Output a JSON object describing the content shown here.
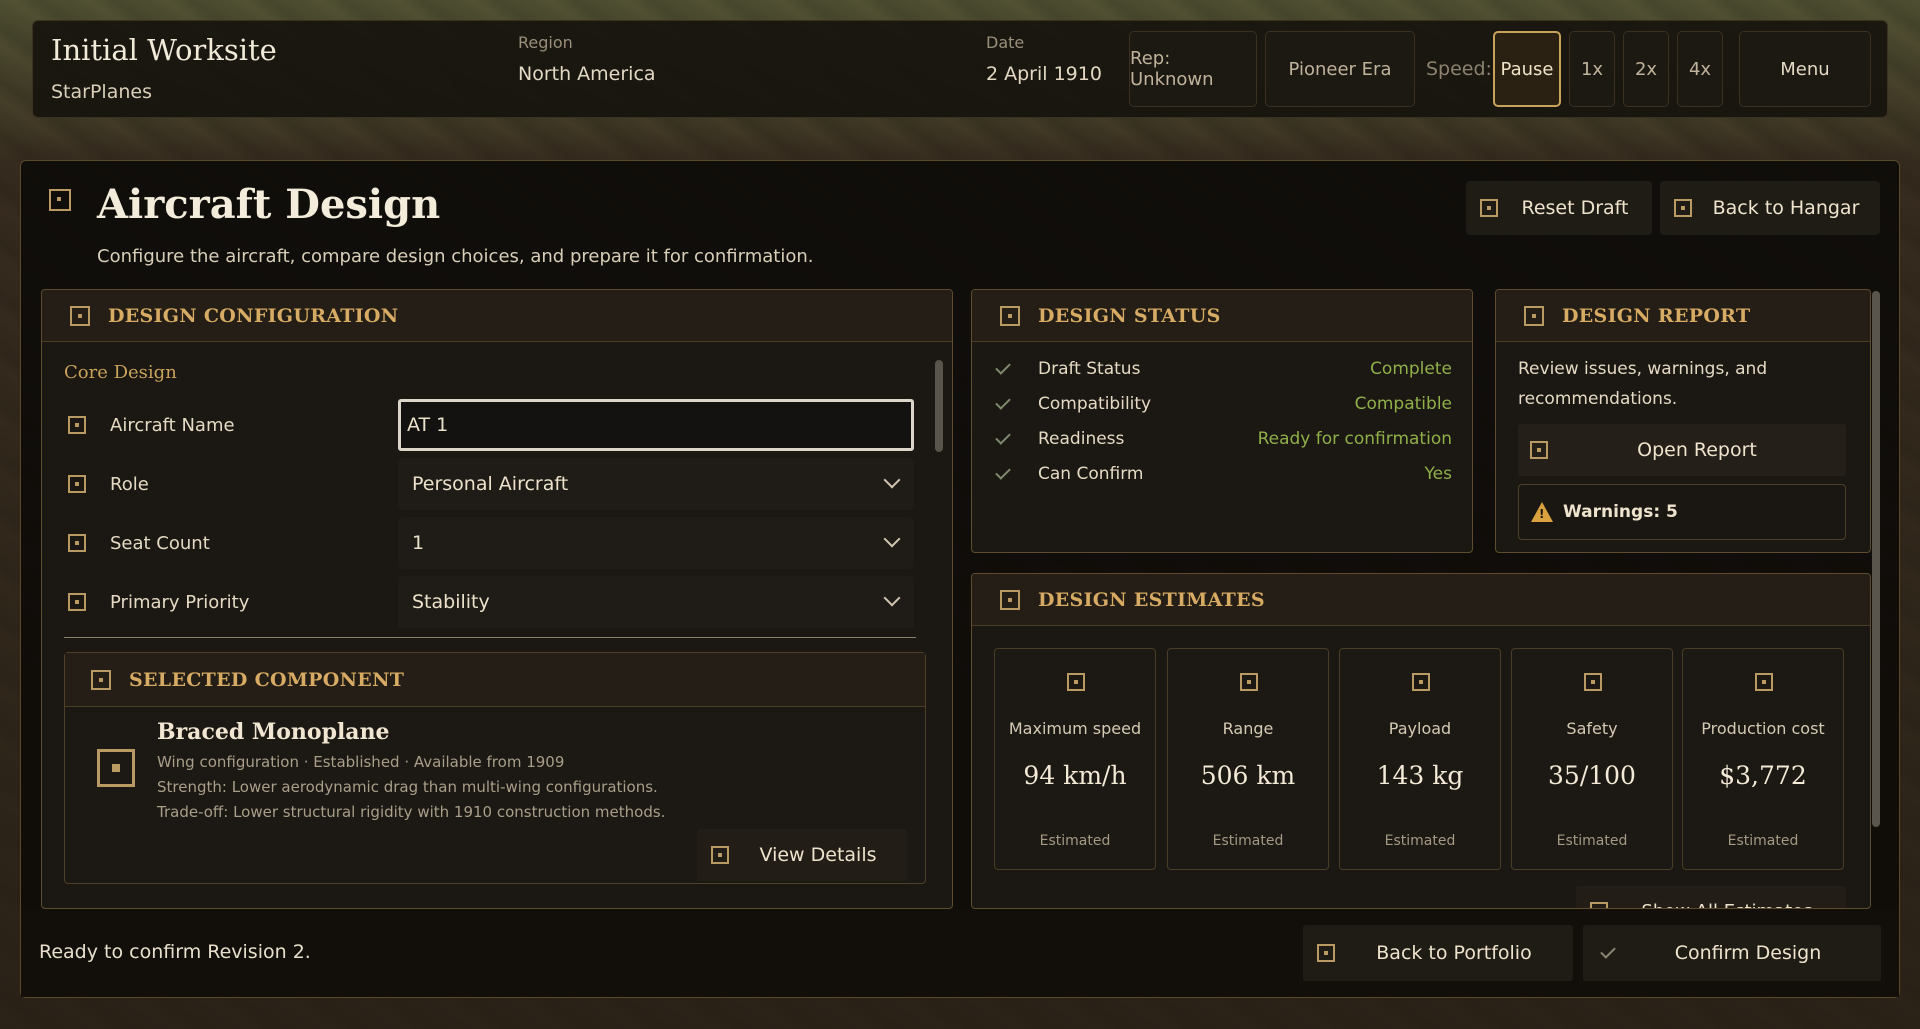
{
  "topbar": {
    "title": "Initial Worksite",
    "subtitle": "StarPlanes",
    "region_label": "Region",
    "region_value": "North America",
    "date_label": "Date",
    "date_value": "2 April 1910",
    "rep": "Rep: Unknown",
    "era": "Pioneer Era",
    "speed_label": "Speed:",
    "speed_options": [
      "Pause",
      "1x",
      "2x",
      "4x"
    ],
    "speed_selected": "Pause",
    "menu": "Menu"
  },
  "header": {
    "title": "Aircraft Design",
    "subtitle": "Configure the aircraft, compare design choices, and prepare it for confirmation.",
    "reset_label": "Reset Draft",
    "back_hangar_label": "Back to Hangar"
  },
  "config": {
    "title": "DESIGN CONFIGURATION",
    "section": "Core Design",
    "fields": [
      {
        "label": "Aircraft Name",
        "value": "AT 1"
      },
      {
        "label": "Role",
        "value": "Personal Aircraft"
      },
      {
        "label": "Seat Count",
        "value": "1"
      },
      {
        "label": "Primary Priority",
        "value": "Stability"
      }
    ],
    "component": {
      "title": "SELECTED COMPONENT",
      "name": "Braced Monoplane",
      "meta": "Wing configuration · Established · Available from 1909",
      "strength": "Strength: Lower aerodynamic drag than multi-wing configurations.",
      "tradeoff": "Trade-off: Lower structural rigidity with 1910 construction methods.",
      "view_label": "View Details"
    }
  },
  "status": {
    "title": "DESIGN STATUS",
    "rows": [
      {
        "label": "Draft Status",
        "value": "Complete"
      },
      {
        "label": "Compatibility",
        "value": "Compatible"
      },
      {
        "label": "Readiness",
        "value": "Ready for confirmation"
      },
      {
        "label": "Can Confirm",
        "value": "Yes"
      }
    ]
  },
  "report": {
    "title": "DESIGN REPORT",
    "text": "Review issues, warnings, and recommendations.",
    "open_label": "Open Report",
    "warnings": "Warnings: 5"
  },
  "estimates": {
    "title": "DESIGN ESTIMATES",
    "cards": [
      {
        "name": "Maximum speed",
        "value": "94 km/h",
        "note": "Estimated"
      },
      {
        "name": "Range",
        "value": "506 km",
        "note": "Estimated"
      },
      {
        "name": "Payload",
        "value": "143 kg",
        "note": "Estimated"
      },
      {
        "name": "Safety",
        "value": "35/100",
        "note": "Estimated"
      },
      {
        "name": "Production cost",
        "value": "$3,772",
        "note": "Estimated"
      }
    ],
    "show_all_label": "Show All Estimates"
  },
  "footer": {
    "status": "Ready to confirm Revision 2.",
    "back_portfolio_label": "Back to Portfolio",
    "confirm_label": "Confirm Design"
  },
  "colors": {
    "accent_gold": "#c9a25b",
    "success_green": "#8fb049",
    "warning_amber": "#d9a23f"
  }
}
